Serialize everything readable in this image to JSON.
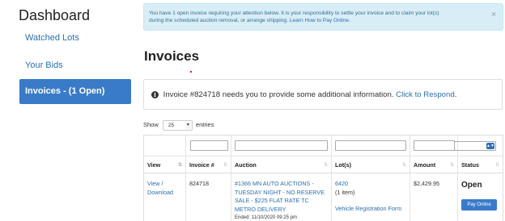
{
  "sidebar": {
    "title": "Dashboard",
    "items": [
      {
        "label": "Watched Lots"
      },
      {
        "label": "Your Bids"
      },
      {
        "label": "Invoices - (1 Open)"
      }
    ]
  },
  "alert": {
    "text_line1": "You have 1 open invoice requiring your attention below. It is your responsibility to settle your invoice and to claim your lot(s)",
    "text_line2": "during the scheduled auction removal, or arrange shipping.",
    "link": "Learn How to Pay Online.",
    "close": "×"
  },
  "page_title": "Invoices",
  "notice": {
    "icon": "i",
    "text": "Invoice #824718 needs you to provide some additional information.",
    "link": "Click to Respond",
    "suffix": "."
  },
  "show": {
    "prefix": "Show",
    "value": "25",
    "suffix": "entries"
  },
  "table": {
    "headers": [
      "View",
      "Invoice #",
      "Auction",
      "Lot(s)",
      "Amount",
      "Status"
    ],
    "sort_glyph": "⇅",
    "rows": [
      {
        "view_line1": "View /",
        "view_line2": "Download",
        "invoice": "824718",
        "auction_line1": "#1366 MN AUTO AUCTIONS -",
        "auction_line2": "TUESDAY NIGHT - NO RESERVE",
        "auction_line3": "SALE - $225 FLAT RATE TC",
        "auction_line4": "METRO DELIVERY",
        "ended": "Ended: 11/10/2020 09:25 pm",
        "lot": "6420",
        "lot_count": "(1 item)",
        "lot_link": "Vehicle Registration Form",
        "amount": "$2,429.95",
        "status": "Open",
        "pay_label": "Pay Online"
      }
    ]
  }
}
